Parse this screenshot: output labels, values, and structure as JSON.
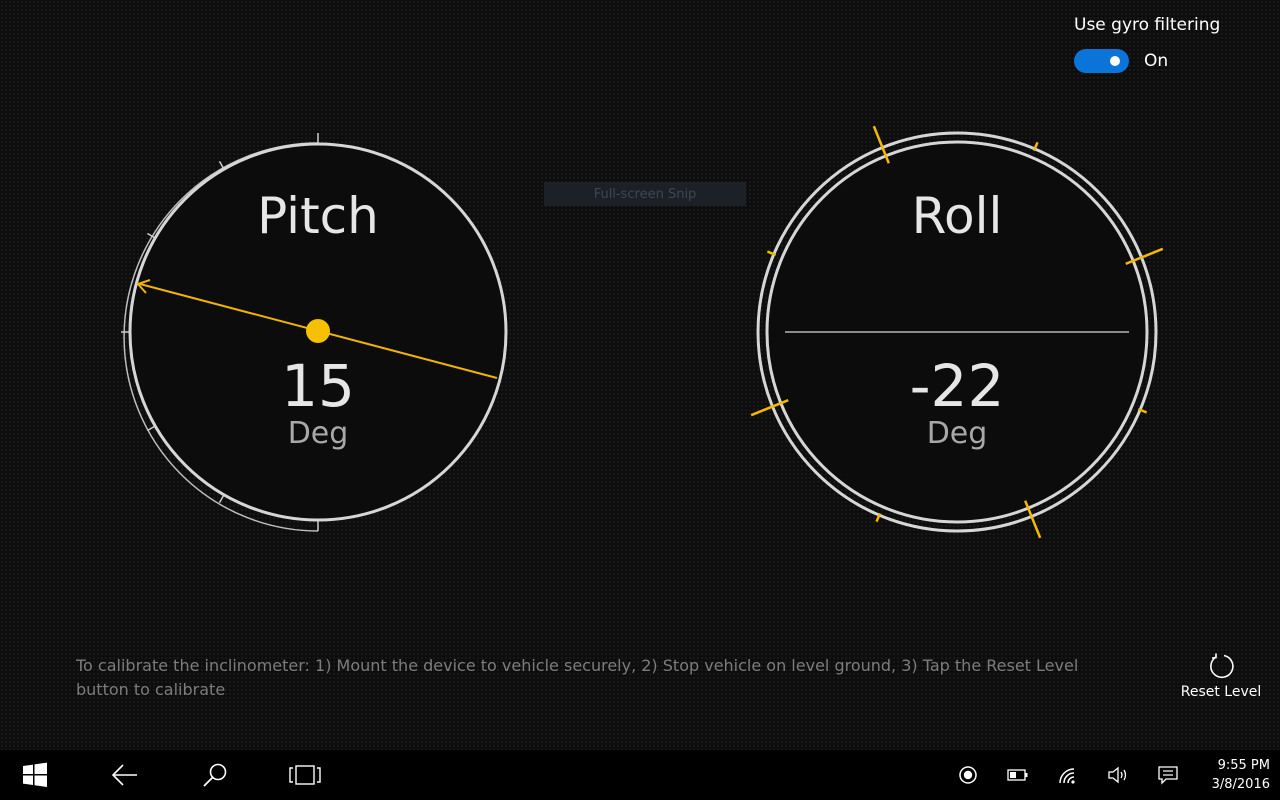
{
  "gyro": {
    "label": "Use gyro filtering",
    "state_text": "On",
    "enabled": true
  },
  "pitch": {
    "title": "Pitch",
    "value": "15",
    "unit": "Deg",
    "angle_deg": 15
  },
  "roll": {
    "title": "Roll",
    "value": "-22",
    "unit": "Deg",
    "angle_deg": -22
  },
  "overlay": {
    "text": "Full-screen Snip"
  },
  "instructions": "To calibrate the inclinometer: 1) Mount the device to vehicle securely, 2) Stop vehicle on level ground, 3) Tap the Reset Level button to calibrate",
  "reset_button": {
    "label": "Reset Level",
    "icon": "refresh-icon"
  },
  "taskbar": {
    "icons": [
      "windows-start-icon",
      "back-arrow-icon",
      "search-icon",
      "task-view-icon",
      "record-icon",
      "battery-icon",
      "wifi-icon",
      "volume-icon",
      "action-center-icon"
    ],
    "time": "9:55 PM",
    "date": "3/8/2016"
  },
  "colors": {
    "accent": "#f5b800",
    "ring": "#d0d0d0",
    "toggle": "#0a74d9",
    "hint_text": "#7c7c7c"
  }
}
